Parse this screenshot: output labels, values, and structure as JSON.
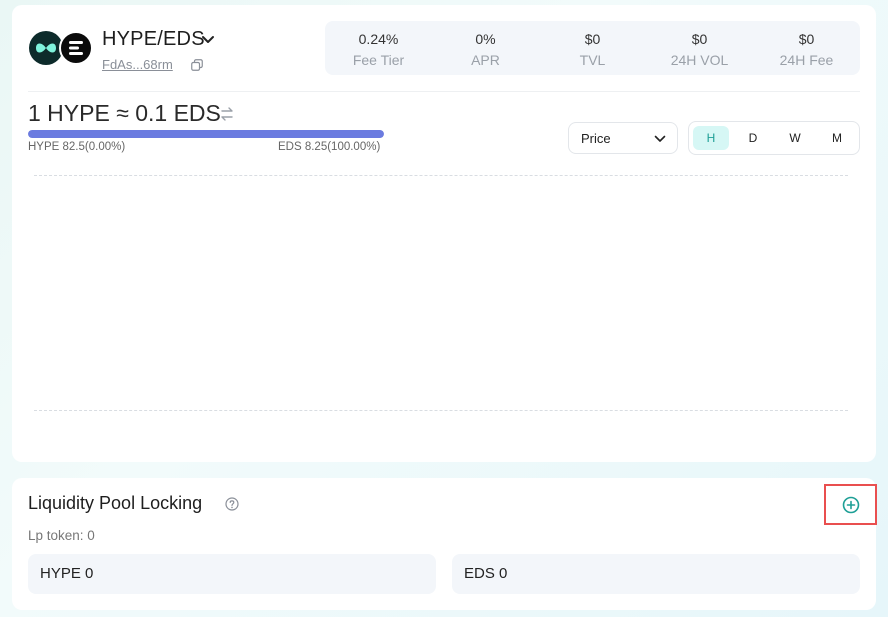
{
  "header": {
    "pair": "HYPE/EDS",
    "address": "FdAs...68rm",
    "token_icons": [
      "hype-token-icon",
      "eds-token-icon"
    ]
  },
  "stats": [
    {
      "value": "0.24%",
      "label": "Fee Tier"
    },
    {
      "value": "0%",
      "label": "APR"
    },
    {
      "value": "$0",
      "label": "TVL"
    },
    {
      "value": "$0",
      "label": "24H VOL"
    },
    {
      "value": "$0",
      "label": "24H Fee"
    }
  ],
  "price": {
    "text": "1 HYPE ≈ 0.1 EDS",
    "left_label": "HYPE 82.5(0.00%)",
    "right_label": "EDS 8.25(100.00%)",
    "progress_percent": 100,
    "progress_color": "#6b7be0"
  },
  "chart_controls": {
    "select_value": "Price",
    "ranges": [
      {
        "label": "H",
        "active": true
      },
      {
        "label": "D",
        "active": false
      },
      {
        "label": "W",
        "active": false
      },
      {
        "label": "M",
        "active": false
      }
    ]
  },
  "lp": {
    "title": "Liquidity Pool Locking",
    "subtitle": "Lp token: 0",
    "boxes": [
      "HYPE 0",
      "EDS 0"
    ]
  },
  "colors": {
    "accent": "#1e9f96",
    "highlight": "#e94f4f"
  }
}
